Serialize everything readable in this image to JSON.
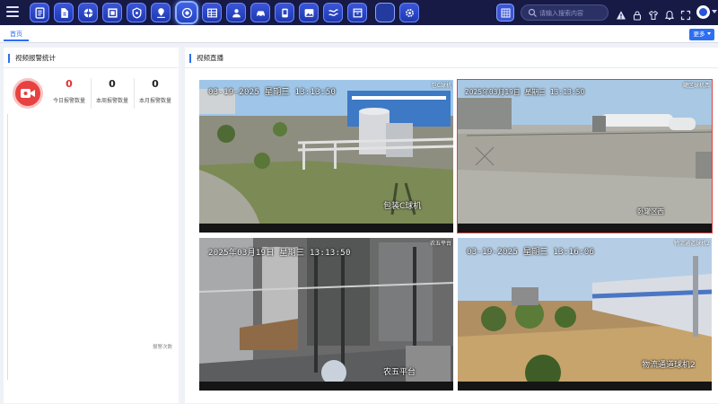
{
  "topbar": {
    "search_placeholder": "请输入搜索内容",
    "nav_icons": [
      "doc-icon",
      "file-icon",
      "network-icon",
      "square-icon",
      "shield-icon",
      "pin-icon",
      "camera-icon",
      "table-icon",
      "users-icon",
      "car-icon",
      "device-icon",
      "image-icon",
      "flow-icon",
      "archive-icon",
      "blank-icon",
      "settings-icon"
    ],
    "active_nav": "camera-icon"
  },
  "tabs": {
    "home": "首页",
    "more": "更多"
  },
  "left_panel": {
    "title": "视频报警统计",
    "stats": [
      {
        "value": "0",
        "label": "今日报警数量"
      },
      {
        "value": "0",
        "label": "本周报警数量"
      },
      {
        "value": "0",
        "label": "本月报警数量"
      }
    ],
    "chart_label": "报警次数"
  },
  "right_panel": {
    "title": "视频直播",
    "feeds": [
      {
        "time": "03-19-2025 星期三 13:13:50",
        "tag": "包C球机",
        "name": "包装C球机"
      },
      {
        "time": "2025年03月19日 星期三 13:13:50",
        "tag": "罐区球机西",
        "name": "卧罐区西"
      },
      {
        "time": "2025年03月19日 星期三 13:13:50",
        "tag": "农五平台",
        "name": "农五平台"
      },
      {
        "time": "03-19-2025 星期三 13:16:06",
        "tag": "物流通道球机2",
        "name": "物流通道球机2"
      }
    ]
  },
  "colors": {
    "topbar": "#161a45",
    "accent": "#2d6ff2",
    "alarm_red": "#e84141",
    "selected_border": "#d84545"
  }
}
